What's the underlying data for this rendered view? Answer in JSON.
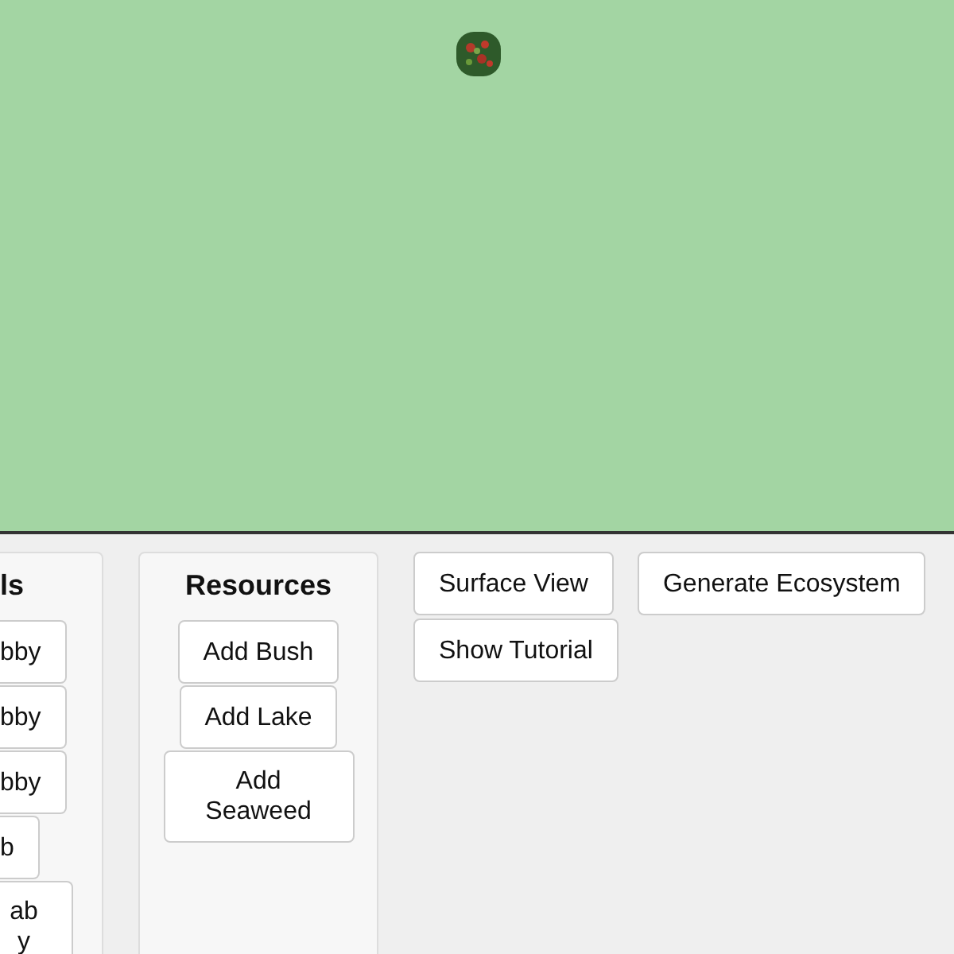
{
  "world": {
    "bushes": [
      {
        "kind": "bush"
      }
    ]
  },
  "panels": [
    {
      "title": "ls",
      "buttons": [
        "bby",
        "bby",
        "bby",
        "b",
        "ab y"
      ],
      "cut": true
    },
    {
      "title": "Resources",
      "buttons": [
        "Add Bush",
        "Add Lake",
        "Add Seaweed"
      ],
      "cut": false
    }
  ],
  "actions": [
    "Surface View",
    "Generate Ecosystem",
    "Show Tutorial"
  ]
}
